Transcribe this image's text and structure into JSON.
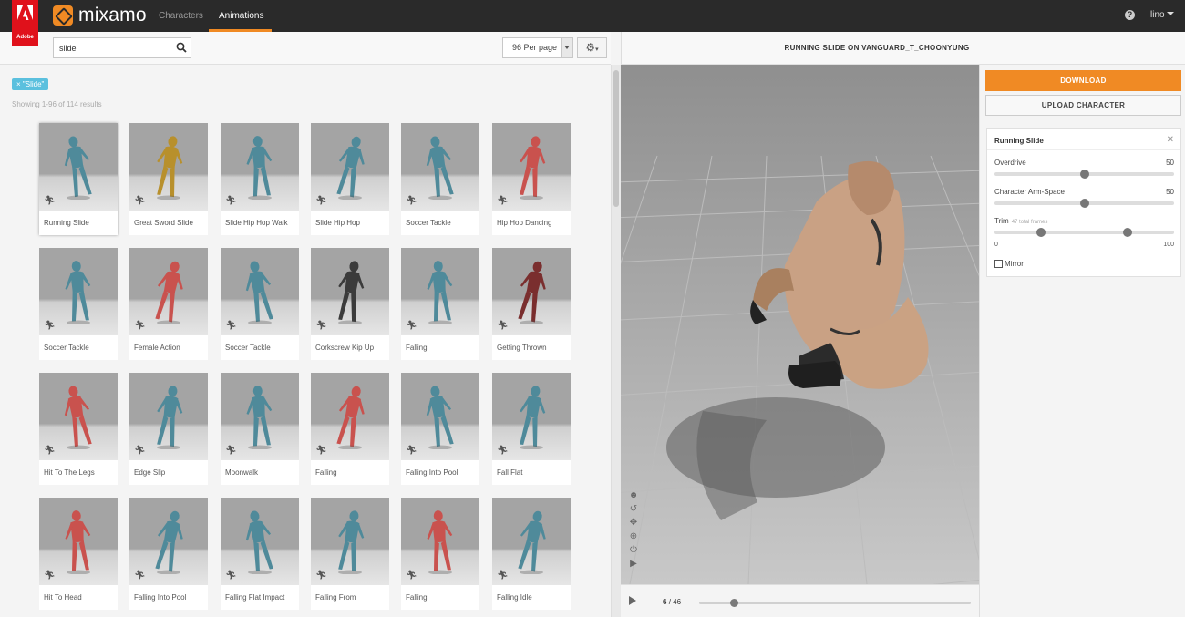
{
  "adobe": {
    "label": "Adobe"
  },
  "brand": {
    "name": "mixamo"
  },
  "nav": {
    "tabs": [
      {
        "label": "Characters",
        "active": false
      },
      {
        "label": "Animations",
        "active": true
      }
    ]
  },
  "user": {
    "name": "lino"
  },
  "search": {
    "value": "slide",
    "placeholder": ""
  },
  "per_page": {
    "selected": "96 Per page"
  },
  "filter": {
    "chip": "× \"Slide\""
  },
  "results": {
    "text": "Showing 1-96 of 114 results"
  },
  "animations": [
    {
      "label": "Running Slide",
      "color": "teal",
      "selected": true
    },
    {
      "label": "Great Sword Slide",
      "color": "gold",
      "selected": false
    },
    {
      "label": "Slide Hip Hop Walk",
      "color": "teal",
      "selected": false
    },
    {
      "label": "Slide Hip Hop",
      "color": "teal",
      "selected": false
    },
    {
      "label": "Soccer Tackle",
      "color": "teal",
      "selected": false
    },
    {
      "label": "Hip Hop Dancing",
      "color": "red",
      "selected": false
    },
    {
      "label": "Soccer Tackle",
      "color": "teal",
      "selected": false
    },
    {
      "label": "Female Action",
      "color": "red",
      "selected": false
    },
    {
      "label": "Soccer Tackle",
      "color": "teal",
      "selected": false
    },
    {
      "label": "Corkscrew Kip Up",
      "color": "dark",
      "selected": false
    },
    {
      "label": "Falling",
      "color": "teal",
      "selected": false
    },
    {
      "label": "Getting Thrown",
      "color": "darkred",
      "selected": false
    },
    {
      "label": "Hit To The Legs",
      "color": "red",
      "selected": false
    },
    {
      "label": "Edge Slip",
      "color": "teal",
      "selected": false
    },
    {
      "label": "Moonwalk",
      "color": "teal",
      "selected": false
    },
    {
      "label": "Falling",
      "color": "red",
      "selected": false
    },
    {
      "label": "Falling Into Pool",
      "color": "teal",
      "selected": false
    },
    {
      "label": "Fall Flat",
      "color": "teal",
      "selected": false
    },
    {
      "label": "Hit To Head",
      "color": "red",
      "selected": false
    },
    {
      "label": "Falling Into Pool",
      "color": "teal",
      "selected": false
    },
    {
      "label": "Falling Flat Impact",
      "color": "teal",
      "selected": false
    },
    {
      "label": "Falling From",
      "color": "teal",
      "selected": false
    },
    {
      "label": "Falling",
      "color": "red",
      "selected": false
    },
    {
      "label": "Falling Idle",
      "color": "teal",
      "selected": false
    }
  ],
  "viewer": {
    "title": "RUNNING SLIDE ON VANGUARD_T_CHOONYUNG",
    "frame_current": "6",
    "frame_total": "/ 46",
    "timeline_progress": 0.13
  },
  "panel": {
    "download": "DOWNLOAD",
    "upload": "UPLOAD CHARACTER",
    "animation_name": "Running Slide",
    "overdrive_label": "Overdrive",
    "overdrive_value": "50",
    "overdrive_fraction": 0.5,
    "armspace_label": "Character Arm-Space",
    "armspace_value": "50",
    "armspace_fraction": 0.5,
    "trim_label": "Trim",
    "trim_sub": "47 total frames",
    "trim_min": "0",
    "trim_max": "100",
    "trim_start_fraction": 0.26,
    "trim_end_fraction": 0.74,
    "mirror_label": "Mirror"
  },
  "colors": {
    "accent": "#f08a24",
    "topbar": "#2a2a2a",
    "adobe_red": "#e0111b",
    "chip": "#5bc0de",
    "teal": "#4f8a9a",
    "red": "#c9524e",
    "gold": "#b8902c",
    "dark": "#3b3b3b",
    "darkred": "#7a2e2e"
  }
}
